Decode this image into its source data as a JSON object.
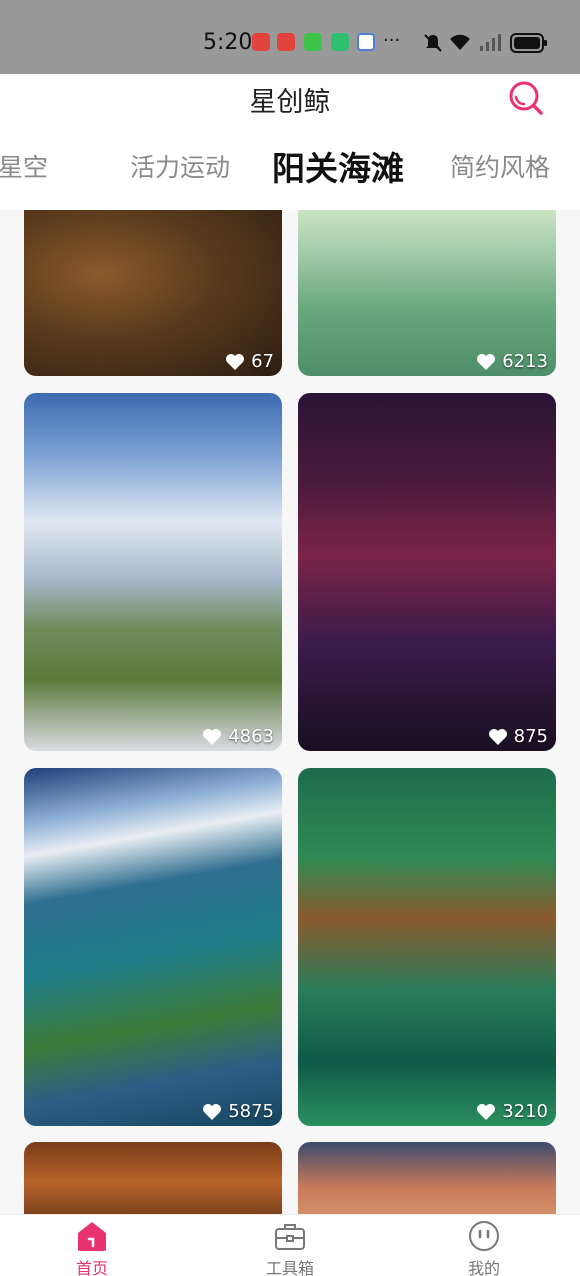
{
  "status_bar": {
    "time": "5:20",
    "more": "···",
    "battery_color": "#111111"
  },
  "header": {
    "title": "星创鲸",
    "search_icon": "search-icon",
    "accent": "#e8336f"
  },
  "tabs": [
    {
      "label": "星空",
      "active": false
    },
    {
      "label": "活力运动",
      "active": false
    },
    {
      "label": "阳关海滩",
      "active": true
    },
    {
      "label": "简约风格",
      "active": false
    }
  ],
  "feed": {
    "cards": [
      {
        "image": "castle-village",
        "likes": "67"
      },
      {
        "image": "lily-pond",
        "likes": "6213"
      },
      {
        "image": "snowy-mountain-cabin",
        "likes": "4863"
      },
      {
        "image": "neon-alley",
        "likes": "875"
      },
      {
        "image": "coastline",
        "likes": "5875"
      },
      {
        "image": "forest-cabin",
        "likes": "3210"
      },
      {
        "image": "warm-interior",
        "likes": ""
      },
      {
        "image": "sunset-clouds",
        "likes": ""
      }
    ]
  },
  "bottom_nav": {
    "items": [
      {
        "label": "首页",
        "icon": "home-icon",
        "active": true
      },
      {
        "label": "工具箱",
        "icon": "toolbox-icon",
        "active": false
      },
      {
        "label": "我的",
        "icon": "profile-icon",
        "active": false
      }
    ]
  }
}
